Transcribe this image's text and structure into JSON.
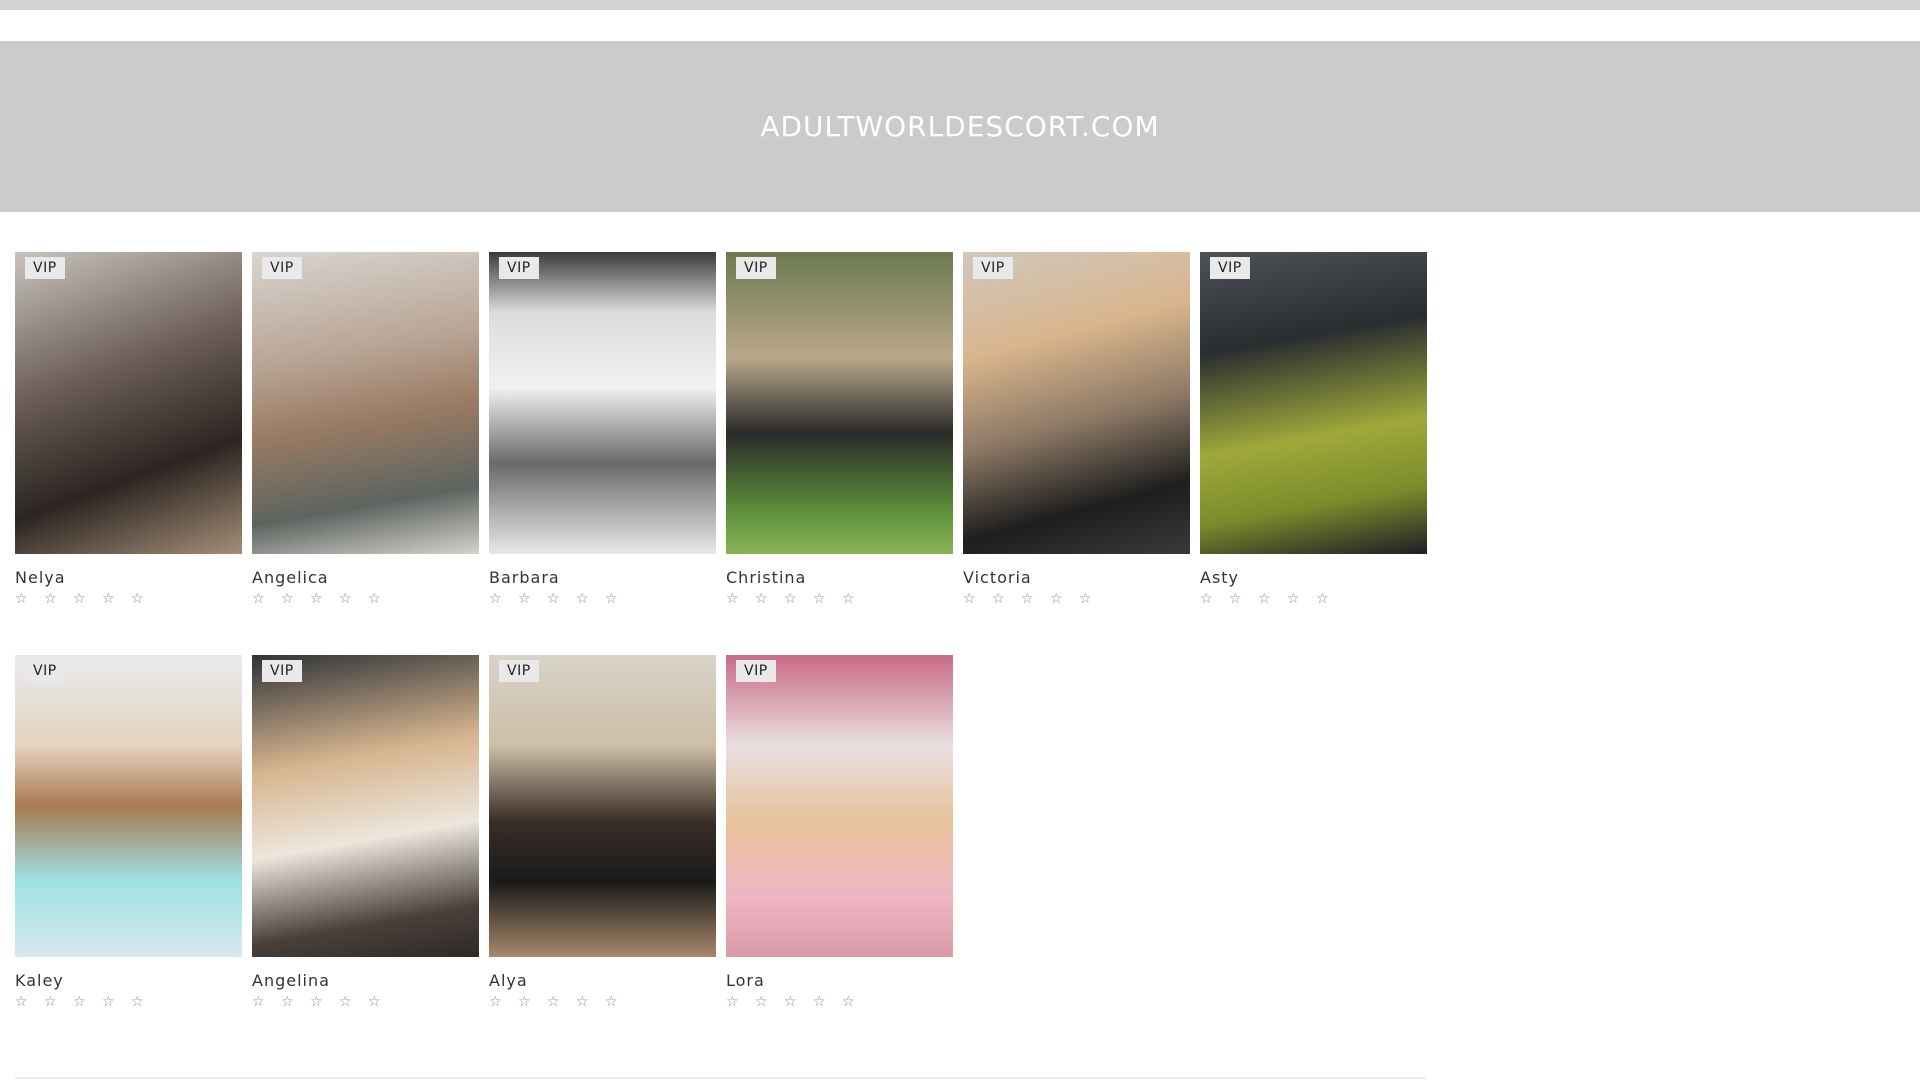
{
  "site": {
    "title": "ADULTWORLDESCORT.COM"
  },
  "badge_label": "VIP",
  "profiles": [
    {
      "name": "Nelya",
      "rating": "☆ ☆ ☆ ☆ ☆"
    },
    {
      "name": "Angelica",
      "rating": "☆ ☆ ☆ ☆ ☆"
    },
    {
      "name": "Barbara",
      "rating": "☆ ☆ ☆ ☆ ☆"
    },
    {
      "name": "Christina",
      "rating": "☆ ☆ ☆ ☆ ☆"
    },
    {
      "name": "Victoria",
      "rating": "☆ ☆ ☆ ☆ ☆"
    },
    {
      "name": "Asty",
      "rating": "☆ ☆ ☆ ☆ ☆"
    },
    {
      "name": "Kaley",
      "rating": "☆ ☆ ☆ ☆ ☆"
    },
    {
      "name": "Angelina",
      "rating": "☆ ☆ ☆ ☆ ☆"
    },
    {
      "name": "Alya",
      "rating": "☆ ☆ ☆ ☆ ☆"
    },
    {
      "name": "Lora",
      "rating": "☆ ☆ ☆ ☆ ☆"
    }
  ],
  "colors": {
    "header_bg": "#cbcbcb",
    "title_text": "#ffffff",
    "badge_bg": "#e9e9e9"
  }
}
